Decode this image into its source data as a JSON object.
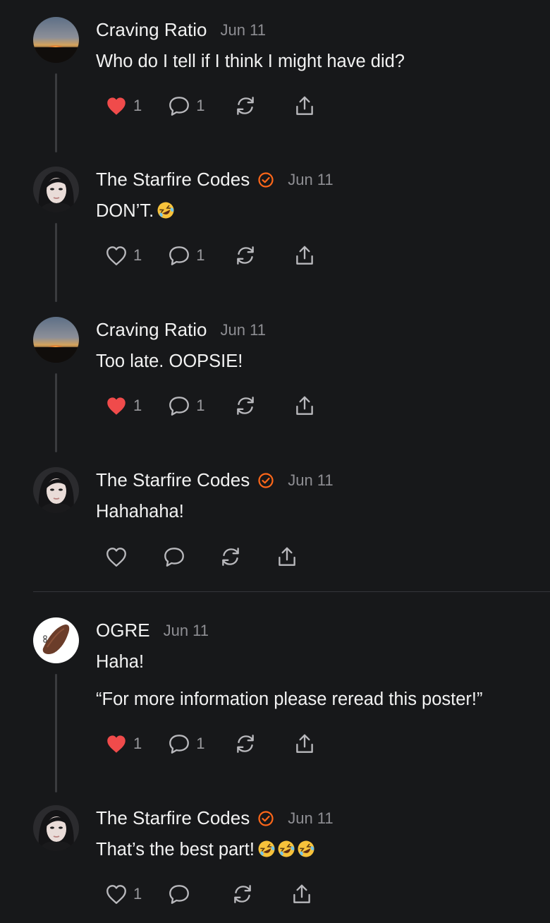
{
  "thread": [
    {
      "author": "Craving Ratio",
      "verified": false,
      "date": "Jun 11",
      "avatar": "sunset-avatar",
      "lines": [
        "Who do I tell if I think I might have did?"
      ],
      "emoji_count": 0,
      "like_count": "1",
      "liked": true,
      "comment_count": "1",
      "has_thread_line": true
    },
    {
      "author": "The Starfire Codes",
      "verified": true,
      "date": "Jun 11",
      "avatar": "portrait-avatar",
      "lines": [
        "DON’T."
      ],
      "emoji_count": 1,
      "like_count": "1",
      "liked": false,
      "comment_count": "1",
      "has_thread_line": true
    },
    {
      "author": "Craving Ratio",
      "verified": false,
      "date": "Jun 11",
      "avatar": "sunset-avatar",
      "lines": [
        "Too late. OOPSIE!"
      ],
      "emoji_count": 0,
      "like_count": "1",
      "liked": true,
      "comment_count": "1",
      "has_thread_line": true
    },
    {
      "author": "The Starfire Codes",
      "verified": true,
      "date": "Jun 11",
      "avatar": "portrait-avatar",
      "lines": [
        "Hahahaha!"
      ],
      "emoji_count": 0,
      "like_count": "",
      "liked": false,
      "comment_count": "",
      "has_thread_line": false
    },
    {
      "author": "OGRE",
      "verified": false,
      "date": "Jun 11",
      "avatar": "ocarina-avatar",
      "lines": [
        "Haha!",
        "“For more information please reread this poster!”"
      ],
      "emoji_count": 0,
      "like_count": "1",
      "liked": true,
      "comment_count": "1",
      "has_thread_line": true
    },
    {
      "author": "The Starfire Codes",
      "verified": true,
      "date": "Jun 11",
      "avatar": "portrait-avatar",
      "lines": [
        "That’s the best part!"
      ],
      "emoji_count": 3,
      "like_count": "1",
      "liked": false,
      "comment_count": "",
      "has_thread_line": false
    }
  ],
  "icons": {
    "emoji": "rolling-on-the-floor-laughing-emoji",
    "like": "heart-icon",
    "comment": "comment-bubble-icon",
    "restack": "restack-icon",
    "share": "share-icon",
    "verified": "verified-check-icon"
  },
  "colors": {
    "background": "#17181a",
    "text": "#f2f2f2",
    "muted": "#8e8e93",
    "like_active": "#f04b4b",
    "verified": "#ff6719",
    "thread_line": "#3a3b3e"
  }
}
